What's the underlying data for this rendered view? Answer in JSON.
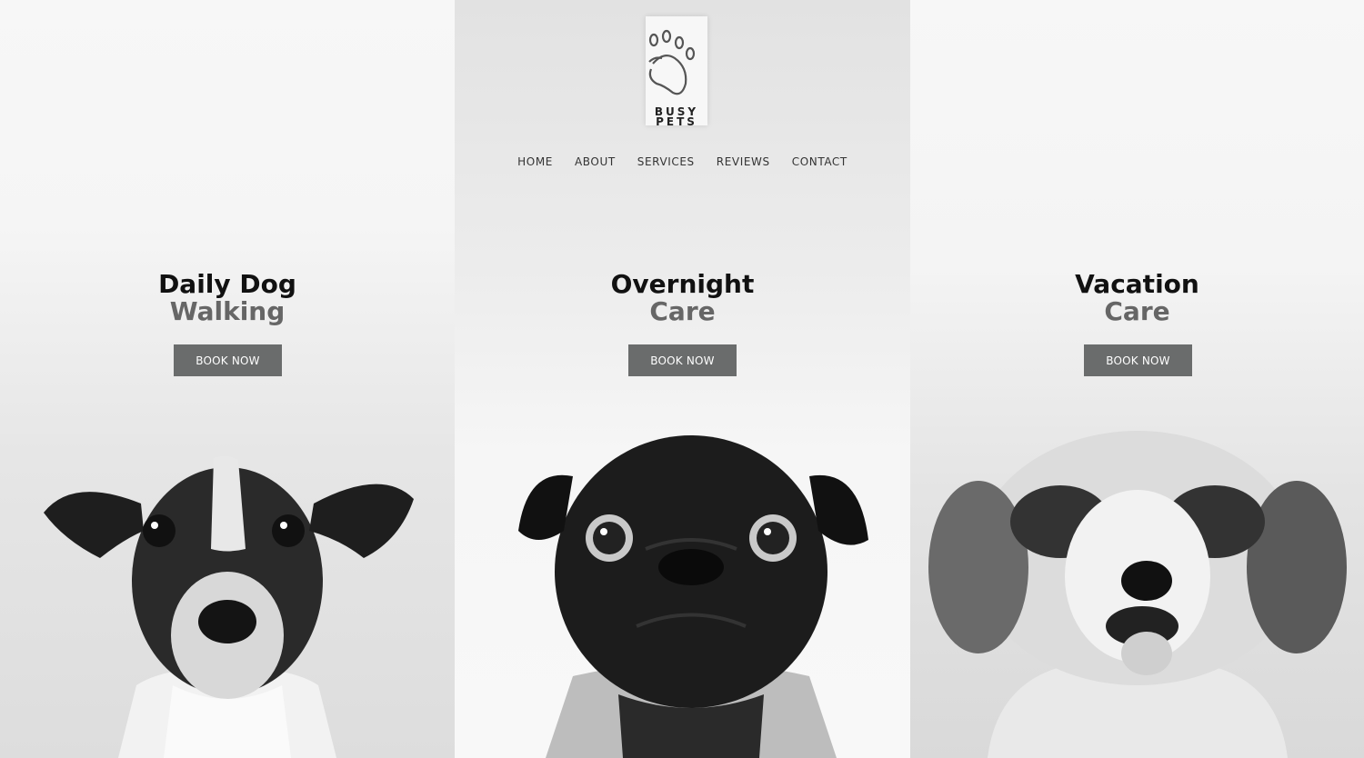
{
  "brand": {
    "line1": "BUSY",
    "line2": "PETS",
    "icon": "paw-print-icon"
  },
  "nav": {
    "items": [
      {
        "label": "HOME"
      },
      {
        "label": "ABOUT"
      },
      {
        "label": "SERVICES"
      },
      {
        "label": "REVIEWS"
      },
      {
        "label": "CONTACT"
      }
    ]
  },
  "services": [
    {
      "title_line1": "Daily Dog",
      "title_line2": "Walking",
      "button_label": "BOOK NOW",
      "image": "jack-russell-dog-photo"
    },
    {
      "title_line1": "Overnight",
      "title_line2": "Care",
      "button_label": "BOOK NOW",
      "image": "pug-dog-photo"
    },
    {
      "title_line1": "Vacation",
      "title_line2": "Care",
      "button_label": "BOOK NOW",
      "image": "shih-tzu-dog-photo"
    }
  ],
  "colors": {
    "button_bg": "#6a6c6c",
    "heading_dark": "#111111",
    "heading_grey": "#666666"
  }
}
